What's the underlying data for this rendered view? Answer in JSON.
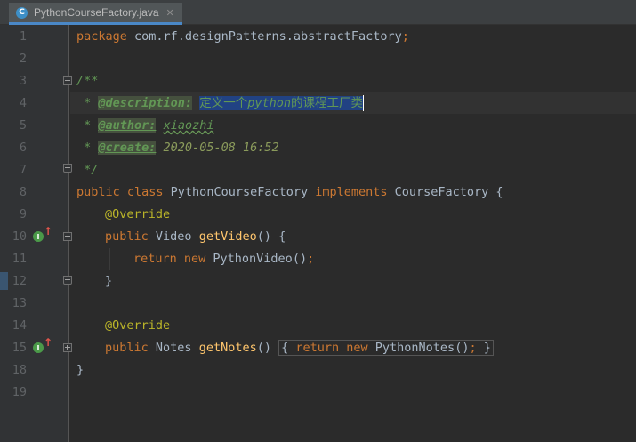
{
  "tab": {
    "icon": "C",
    "title": "PythonCourseFactory.java",
    "close_icon": "close-icon"
  },
  "line_numbers": [
    "1",
    "2",
    "3",
    "4",
    "5",
    "6",
    "7",
    "8",
    "9",
    "10",
    "11",
    "12",
    "13",
    "14",
    "15",
    "18",
    "19"
  ],
  "code": {
    "l1_kw": "package",
    "l1_rest": " com.rf.designPatterns.abstractFactory",
    "l1_semi": ";",
    "l3": "/**",
    "l4_star": " * ",
    "l4_tag": "@description:",
    "l4_sp": " ",
    "l4_a": "定义一个",
    "l4_b": "python",
    "l4_c": "的课程工厂类",
    "l5_star": " * ",
    "l5_tag": "@author:",
    "l5_sp": " ",
    "l5_val": "xiaozhi",
    "l6_star": " * ",
    "l6_tag": "@create:",
    "l6_val": " 2020-05-08 16:52",
    "l7": " */",
    "l8_kw1": "public class",
    "l8_name": " PythonCourseFactory ",
    "l8_kw2": "implements",
    "l8_rest": " CourseFactory {",
    "l9_ann": "@Override",
    "l10_kw": "public",
    "l10_type": " Video ",
    "l10_fn": "getVideo",
    "l10_rest": "() {",
    "l11_kw": "return new",
    "l11_rest": " PythonVideo()",
    "l11_semi": ";",
    "l12": "}",
    "l14_ann": "@Override",
    "l15_kw": "public",
    "l15_type": " Notes ",
    "l15_fn": "getNotes",
    "l15_paren": "() ",
    "l15_open": "{",
    "l15_ret": " return new",
    "l15_body": " PythonNotes()",
    "l15_semi": ";",
    "l15_close": " }",
    "l18": "}"
  },
  "colors": {
    "background": "#2b2b2b",
    "gutter": "#313335",
    "keyword": "#cc7832",
    "annotation": "#bbb529",
    "method": "#ffc66d",
    "doc_comment": "#629755",
    "selection": "#214283"
  }
}
